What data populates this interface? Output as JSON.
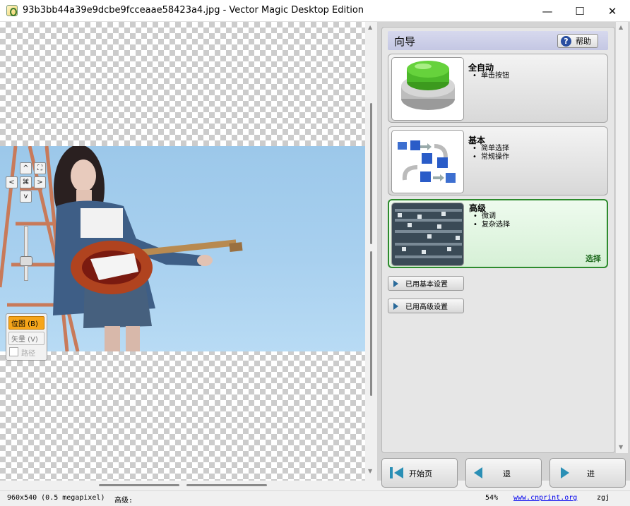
{
  "window": {
    "title": "93b3bb44a39e9dcbe9fcceaae58423a4.jpg - Vector Magic Desktop Edition",
    "minimize_glyph": "—",
    "maximize_glyph": "☐",
    "close_glyph": "✕"
  },
  "canvas": {
    "nav": {
      "up": "^",
      "down": "v",
      "left": "<",
      "right": ">",
      "center": "⌘",
      "fit": "⛶"
    },
    "view_modes": [
      {
        "label": "位图 (B)",
        "active": true
      },
      {
        "label": "矢量 (V)",
        "active": false
      }
    ],
    "path_checkbox_label": "路径"
  },
  "wizard": {
    "title": "向导",
    "help_label": "帮助",
    "modes": [
      {
        "title": "全自动",
        "bullets": [
          "单击按钮"
        ],
        "icon": "green-push-button-icon",
        "selected": false
      },
      {
        "title": "基本",
        "bullets": [
          "简单选择",
          "常规操作"
        ],
        "icon": "workflow-arrows-icon",
        "selected": false
      },
      {
        "title": "高级",
        "bullets": [
          "微调",
          "复杂选择"
        ],
        "icon": "mixing-console-icon",
        "selected": true,
        "select_label": "选择"
      }
    ],
    "settings_buttons": [
      "已用基本设置",
      "已用高级设置"
    ]
  },
  "bottom_nav": {
    "home": "开始页",
    "back": "退",
    "forward": "进"
  },
  "status": {
    "image_info": "960x540 (0.5 megapixel)",
    "mode": "高级:",
    "zoom": "54%",
    "link": "www.cnprint.org",
    "user": "zgj"
  },
  "colors": {
    "active_view": "#f6a51a",
    "selected_card_border": "#2e8b2e",
    "wizard_header": "#c4c7e3",
    "photo_background": "#a8d0ef"
  }
}
